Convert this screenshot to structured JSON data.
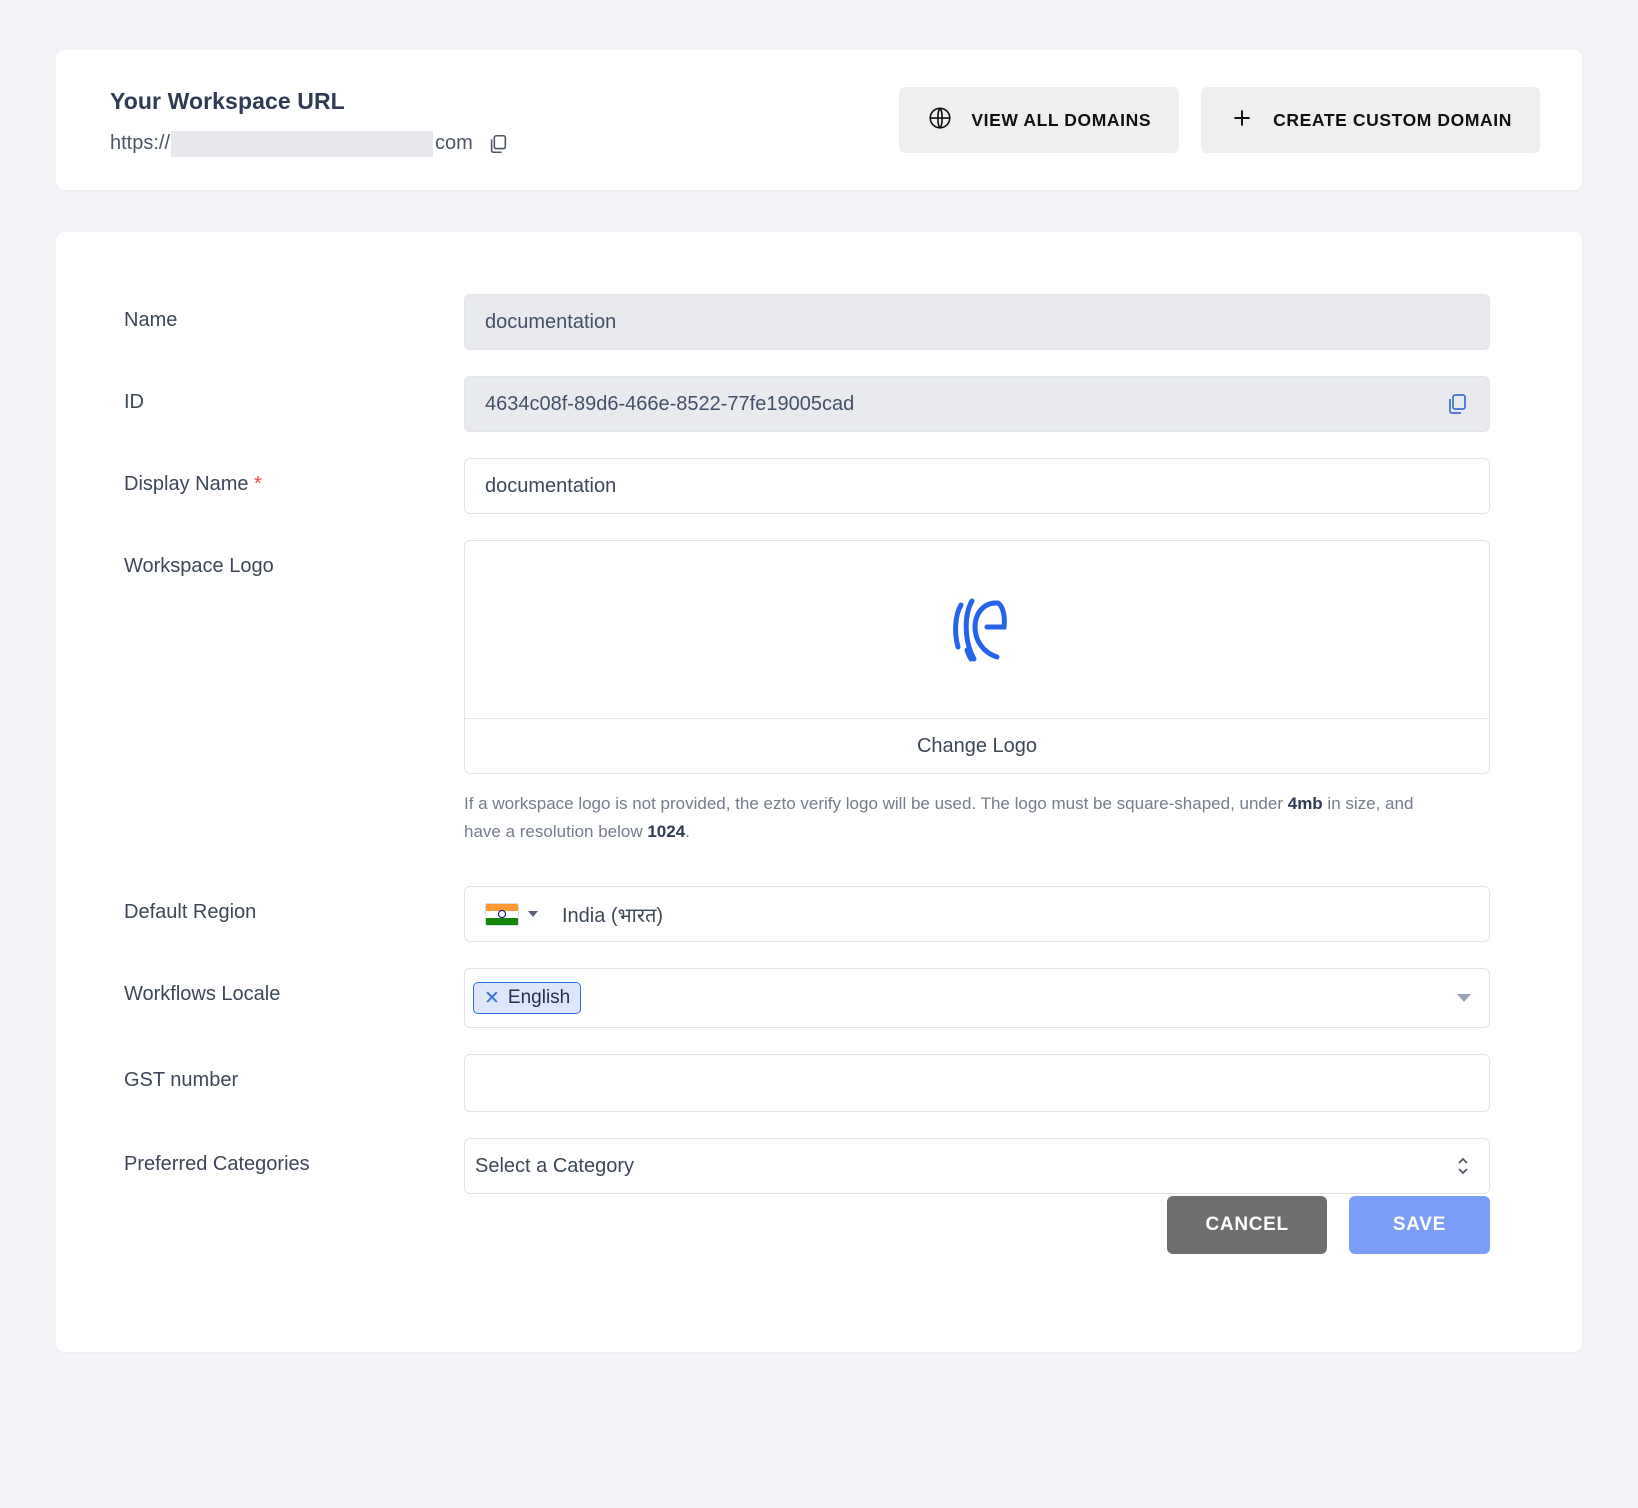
{
  "url_card": {
    "title": "Your Workspace URL",
    "url_prefix": "https://",
    "url_suffix": "com",
    "copy_icon": "copy-icon",
    "view_all_domains_label": "VIEW ALL DOMAINS",
    "view_all_domains_icon": "globe-icon",
    "create_custom_domain_label": "CREATE CUSTOM DOMAIN",
    "create_custom_domain_icon": "plus-icon"
  },
  "form": {
    "name": {
      "label": "Name",
      "value": "documentation"
    },
    "id": {
      "label": "ID",
      "value": "4634c08f-89d6-466e-8522-77fe19005cad",
      "copy_icon": "copy-icon"
    },
    "display_name": {
      "label": "Display Name",
      "required_marker": "*",
      "value": "documentation"
    },
    "logo": {
      "label": "Workspace Logo",
      "logo_icon": "ezto-verify-logo",
      "change_label": "Change Logo",
      "help_part1": "If a workspace logo is not provided, the ezto verify logo will be used. The logo must be square-shaped, under ",
      "help_bold1": "4mb",
      "help_part2": " in size, and have a resolution below ",
      "help_bold2": "1024",
      "help_part3": "."
    },
    "region": {
      "label": "Default Region",
      "flag_icon": "india-flag-icon",
      "value": "India (भारत)"
    },
    "locale": {
      "label": "Workflows Locale",
      "chips": [
        "English"
      ],
      "remove_icon": "close-icon",
      "dropdown_icon": "chevron-down-icon"
    },
    "gst": {
      "label": "GST number",
      "value": "",
      "placeholder": ""
    },
    "categories": {
      "label": "Preferred Categories",
      "value": "Select a Category",
      "dropdown_icon": "updown-arrows-icon"
    }
  },
  "footer": {
    "cancel_label": "CANCEL",
    "save_label": "SAVE"
  },
  "colors": {
    "accent_blue": "#2f6fe4",
    "save_blue": "#7a9ef7",
    "cancel_gray": "#6e6e6e",
    "required_red": "#e04a3f",
    "page_bg": "#f1f3f7"
  }
}
